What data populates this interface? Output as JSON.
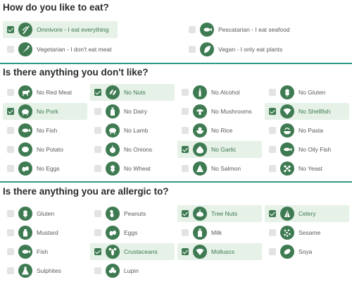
{
  "colors": {
    "accent": "#3f7b52",
    "rule": "#2e9a89",
    "selected_bg": "#e6f1e7"
  },
  "section1": {
    "title": "How do you like to eat?",
    "options": [
      {
        "label": "Omnivore - I eat everything",
        "checked": true,
        "icon": "cutlery-icon"
      },
      {
        "label": "Pescatarian - I eat seafood",
        "checked": false,
        "icon": "fish-icon"
      },
      {
        "label": "Vegetarian - I don't eat meat",
        "checked": false,
        "icon": "carrot-icon"
      },
      {
        "label": "Vegan - I only eat plants",
        "checked": false,
        "icon": "leaf-icon"
      }
    ]
  },
  "section2": {
    "title": "Is there anything you don't like?",
    "options": [
      {
        "label": "No Red Meat",
        "checked": false,
        "icon": "cow-icon"
      },
      {
        "label": "No Nuts",
        "checked": true,
        "icon": "nut-icon"
      },
      {
        "label": "No Alcohol",
        "checked": false,
        "icon": "bottle-icon"
      },
      {
        "label": "No Gluten",
        "checked": false,
        "icon": "wheat-icon"
      },
      {
        "label": "No Pork",
        "checked": true,
        "icon": "pig-icon"
      },
      {
        "label": "No Dairy",
        "checked": false,
        "icon": "milk-icon"
      },
      {
        "label": "No Mushrooms",
        "checked": false,
        "icon": "mushroom-icon"
      },
      {
        "label": "No Shellfish",
        "checked": true,
        "icon": "shell-icon"
      },
      {
        "label": "No Fish",
        "checked": false,
        "icon": "fish-icon"
      },
      {
        "label": "No Lamb",
        "checked": false,
        "icon": "lamb-icon"
      },
      {
        "label": "No Rice",
        "checked": false,
        "icon": "rice-bowl-icon"
      },
      {
        "label": "No Pasta",
        "checked": false,
        "icon": "pasta-icon"
      },
      {
        "label": "No Potato",
        "checked": false,
        "icon": "potato-icon"
      },
      {
        "label": "No Onions",
        "checked": false,
        "icon": "onion-icon"
      },
      {
        "label": "No Garlic",
        "checked": true,
        "icon": "garlic-icon"
      },
      {
        "label": "No Oily Fish",
        "checked": false,
        "icon": "oily-fish-icon"
      },
      {
        "label": "No Eggs",
        "checked": false,
        "icon": "eggs-icon"
      },
      {
        "label": "No Wheat",
        "checked": false,
        "icon": "wheat-icon"
      },
      {
        "label": "No Salmon",
        "checked": false,
        "icon": "salmon-icon"
      },
      {
        "label": "No Yeast",
        "checked": false,
        "icon": "yeast-icon"
      }
    ]
  },
  "section3": {
    "title": "Is there anything you are allergic to?",
    "options": [
      {
        "label": "Gluten",
        "checked": false,
        "icon": "wheat-icon"
      },
      {
        "label": "Peanuts",
        "checked": false,
        "icon": "peanut-icon"
      },
      {
        "label": "Tree Nuts",
        "checked": true,
        "icon": "tree-nut-icon"
      },
      {
        "label": "Celery",
        "checked": true,
        "icon": "celery-icon"
      },
      {
        "label": "Mustard",
        "checked": false,
        "icon": "mustard-icon"
      },
      {
        "label": "Eggs",
        "checked": false,
        "icon": "eggs-icon"
      },
      {
        "label": "Milk",
        "checked": false,
        "icon": "milk-icon"
      },
      {
        "label": "Sesame",
        "checked": false,
        "icon": "sesame-icon"
      },
      {
        "label": "Fish",
        "checked": false,
        "icon": "fish-icon"
      },
      {
        "label": "Crustaceans",
        "checked": true,
        "icon": "lobster-icon"
      },
      {
        "label": "Molluscs",
        "checked": true,
        "icon": "shell-icon"
      },
      {
        "label": "Soya",
        "checked": false,
        "icon": "soy-icon"
      },
      {
        "label": "Sulphites",
        "checked": false,
        "icon": "flask-icon"
      },
      {
        "label": "Lupin",
        "checked": false,
        "icon": "lupin-icon"
      }
    ]
  }
}
